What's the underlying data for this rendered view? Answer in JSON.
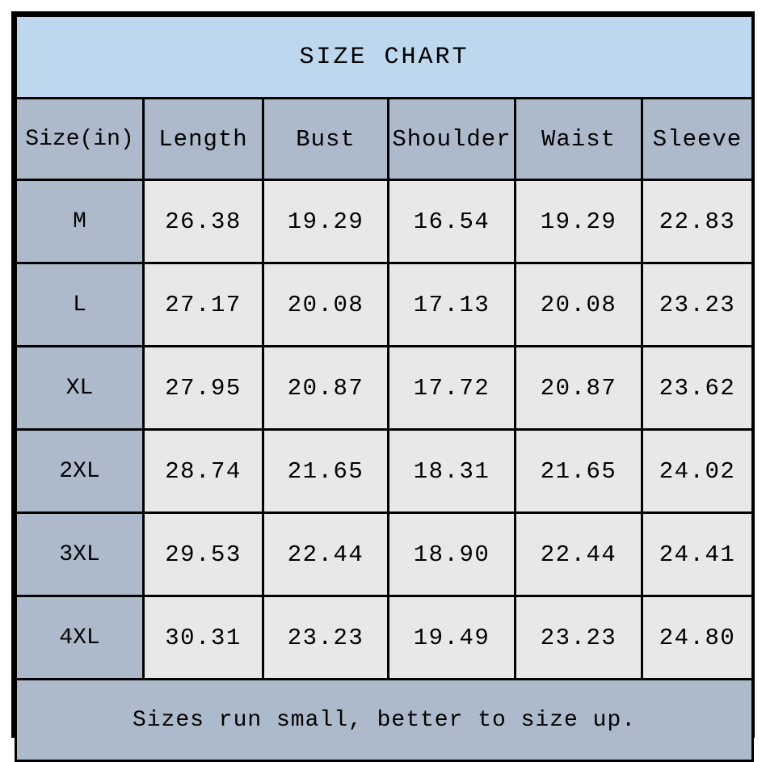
{
  "title": "SIZE CHART",
  "columns": [
    "Size(in)",
    "Length",
    "Bust",
    "Shoulder",
    "Waist",
    "Sleeve"
  ],
  "note": "Sizes run small, better to size up.",
  "colors": {
    "title_bg": "#bdd7ee",
    "header_bg": "#adbacb",
    "size_col_bg": "#adbacb",
    "data_bg": "#e8e8e8",
    "note_bg": "#adbacb",
    "border": "#000000",
    "text": "#000000",
    "page_bg": "#ffffff"
  },
  "chart_data": {
    "type": "table",
    "title": "SIZE CHART",
    "unit": "in",
    "columns": [
      "Size(in)",
      "Length",
      "Bust",
      "Shoulder",
      "Waist",
      "Sleeve"
    ],
    "rows": [
      {
        "size": "M",
        "length": "26.38",
        "bust": "19.29",
        "shoulder": "16.54",
        "waist": "19.29",
        "sleeve": "22.83"
      },
      {
        "size": "L",
        "length": "27.17",
        "bust": "20.08",
        "shoulder": "17.13",
        "waist": "20.08",
        "sleeve": "23.23"
      },
      {
        "size": "XL",
        "length": "27.95",
        "bust": "20.87",
        "shoulder": "17.72",
        "waist": "20.87",
        "sleeve": "23.62"
      },
      {
        "size": "2XL",
        "length": "28.74",
        "bust": "21.65",
        "shoulder": "18.31",
        "waist": "21.65",
        "sleeve": "24.02"
      },
      {
        "size": "3XL",
        "length": "29.53",
        "bust": "22.44",
        "shoulder": "18.90",
        "waist": "22.44",
        "sleeve": "24.41"
      },
      {
        "size": "4XL",
        "length": "30.31",
        "bust": "23.23",
        "shoulder": "19.49",
        "waist": "23.23",
        "sleeve": "24.80"
      }
    ],
    "note": "Sizes run small, better to size up."
  }
}
